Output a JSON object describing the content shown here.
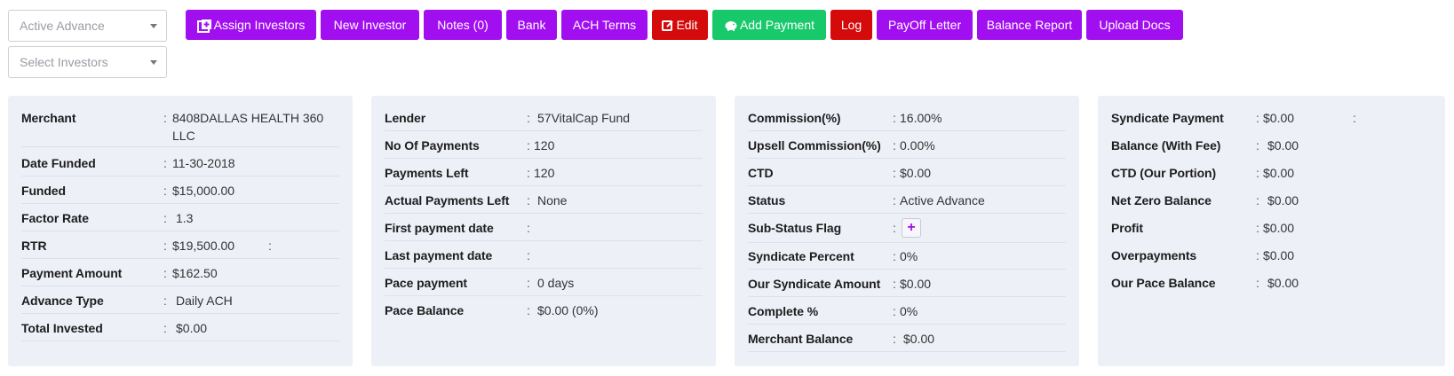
{
  "filters": {
    "status_select": "Active Advance",
    "investors_select": "Select Investors"
  },
  "toolbar": {
    "assign_investors": "Assign Investors",
    "new_investor": "New Investor",
    "notes": "Notes (0)",
    "bank": "Bank",
    "ach_terms": "ACH Terms",
    "edit": "Edit",
    "add_payment": "Add Payment",
    "log": "Log",
    "payoff_letter": "PayOff Letter",
    "balance_report": "Balance Report",
    "upload_docs": "Upload Docs"
  },
  "colors": {
    "purple": "#a10ff0",
    "red": "#d50a0a",
    "green": "#18c96b",
    "card_bg": "#eef0f8"
  },
  "icons": {
    "assign_investors": "plus-square-icon",
    "edit": "edit-icon",
    "add_payment": "piggy-bank-icon",
    "sub_status": "plus-icon",
    "select_caret": "caret-down-icon"
  },
  "card1": {
    "merchant_label": "Merchant",
    "merchant_line1": "8408DALLAS HEALTH 360",
    "merchant_line2": "LLC",
    "date_funded_label": "Date Funded",
    "date_funded": "11-30-2018",
    "funded_label": "Funded",
    "funded": "$15,000.00",
    "factor_rate_label": "Factor Rate",
    "factor_rate": "1.3",
    "rtr_label": "RTR",
    "rtr": "$19,500.00",
    "payment_amount_label": "Payment Amount",
    "payment_amount": "$162.50",
    "advance_type_label": "Advance Type",
    "advance_type": "Daily ACH",
    "total_invested_label": "Total Invested",
    "total_invested": "$0.00"
  },
  "card2": {
    "lender_label": "Lender",
    "lender": "57VitalCap Fund",
    "no_payments_label": "No Of Payments",
    "no_payments": "120",
    "payments_left_label": "Payments Left",
    "payments_left": "120",
    "actual_payments_left_label": "Actual Payments Left",
    "actual_payments_left": "None",
    "first_payment_label": "First payment date",
    "last_payment_label": "Last payment date",
    "pace_payment_label": "Pace payment",
    "pace_payment": "0 days",
    "pace_balance_label": "Pace Balance",
    "pace_balance": "$0.00 (0%)"
  },
  "card3": {
    "commission_label": "Commission(%)",
    "commission": "16.00%",
    "upsell_label": "Upsell Commission(%)",
    "upsell": "0.00%",
    "ctd_label": "CTD",
    "ctd": "$0.00",
    "status_label": "Status",
    "status": "Active Advance",
    "sub_status_label": "Sub-Status Flag",
    "syndicate_percent_label": "Syndicate Percent",
    "syndicate_percent": "0%",
    "our_syndicate_label": "Our Syndicate Amount",
    "our_syndicate": "$0.00",
    "complete_label": "Complete %",
    "complete": "0%",
    "merchant_balance_label": "Merchant Balance",
    "merchant_balance": "$0.00"
  },
  "card4": {
    "syndicate_payment_label": "Syndicate Payment",
    "syndicate_payment": "$0.00",
    "balance_fee_label": "Balance (With Fee)",
    "balance_fee": "$0.00",
    "ctd_portion_label": "CTD (Our Portion)",
    "ctd_portion": "$0.00",
    "net_zero_label": "Net Zero Balance",
    "net_zero": "$0.00",
    "profit_label": "Profit",
    "profit": "$0.00",
    "overpayments_label": "Overpayments",
    "overpayments": "$0.00",
    "our_pace_label": "Our Pace Balance",
    "our_pace": "$0.00"
  }
}
